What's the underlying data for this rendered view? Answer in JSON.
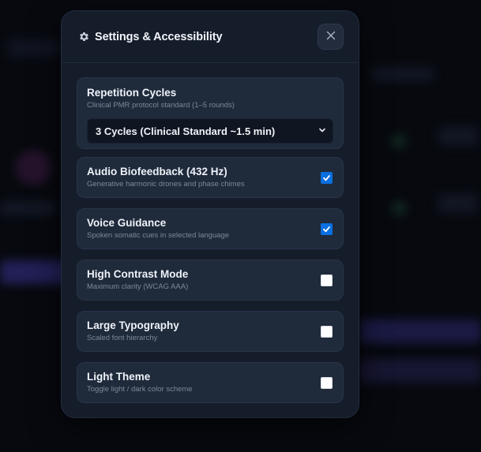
{
  "modal": {
    "title": "Settings & Accessibility"
  },
  "repetition": {
    "label": "Repetition Cycles",
    "description": "Clinical PMR protocol standard (1–5 rounds)",
    "selected": "3 Cycles (Clinical Standard ~1.5 min)"
  },
  "toggles": [
    {
      "label": "Audio Biofeedback (432 Hz)",
      "description": "Generative harmonic drones and phase chimes",
      "checked": true
    },
    {
      "label": "Voice Guidance",
      "description": "Spoken somatic cues in selected language",
      "checked": true
    },
    {
      "label": "High Contrast Mode",
      "description": "Maximum clarity (WCAG AAA)",
      "checked": false
    },
    {
      "label": "Large Typography",
      "description": "Scaled font hierarchy",
      "checked": false
    },
    {
      "label": "Light Theme",
      "description": "Toggle light / dark color scheme",
      "checked": false
    }
  ],
  "colors": {
    "accent": "#0a6fe0",
    "modal_bg": "#151d2b",
    "card_bg": "#1f2a3b",
    "page_bg": "#07090f"
  },
  "icons": {
    "title": "gear-icon",
    "close": "close-icon",
    "select": "chevron-down-icon",
    "check": "checkmark-icon"
  }
}
